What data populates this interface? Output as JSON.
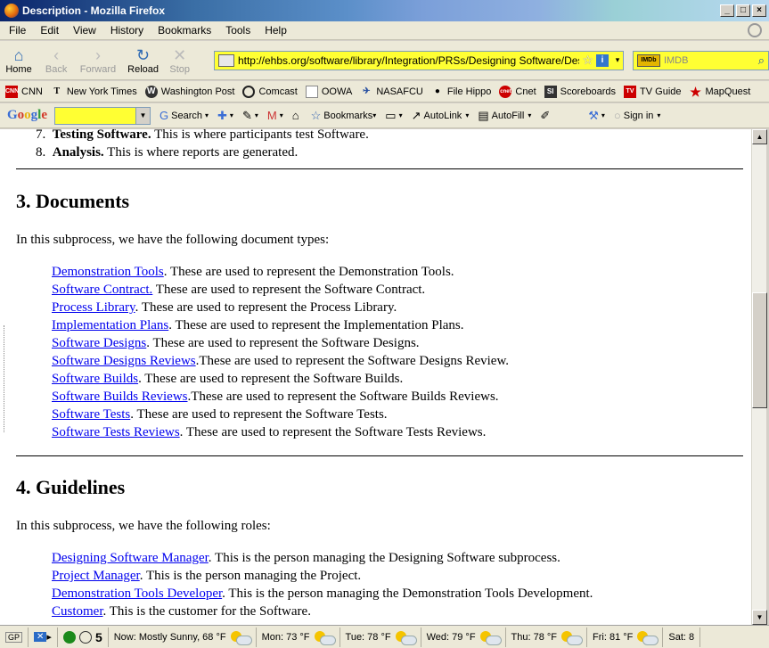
{
  "window": {
    "title": "Description - Mozilla Firefox"
  },
  "menu": [
    "File",
    "Edit",
    "View",
    "History",
    "Bookmarks",
    "Tools",
    "Help"
  ],
  "nav": {
    "home": "Home",
    "back": "Back",
    "forward": "Forward",
    "reload": "Reload",
    "stop": "Stop",
    "url": "http://ehbs.org/software/library/Integration/PRSs/Designing Software/Descr",
    "search_placeholder": "IMDB",
    "search_engine": "IMDb"
  },
  "bookmarks": [
    "CNN",
    "New York Times",
    "Washington Post",
    "Comcast",
    "OOWA",
    "NASAFCU",
    "File Hippo",
    "Cnet",
    "Scoreboards",
    "TV Guide",
    "MapQuest"
  ],
  "google_toolbar": {
    "logo": [
      "G",
      "o",
      "o",
      "g",
      "l",
      "e"
    ],
    "search": "Search",
    "bookmarks": "Bookmarks",
    "autolink": "AutoLink",
    "autofill": "AutoFill",
    "signin": "Sign in"
  },
  "content": {
    "steps": [
      {
        "num": "7.",
        "bold": "Testing Software.",
        "text": " This is where participants test Software."
      },
      {
        "num": "8.",
        "bold": "Analysis.",
        "text": " This is where reports are generated."
      }
    ],
    "documents": {
      "heading": "3. Documents",
      "intro": "In this subprocess, we have the following document types:",
      "items": [
        {
          "link": "Demonstration Tools",
          "text": ". These are used to represent the Demonstration Tools."
        },
        {
          "link": "Software Contract.",
          "text": " These are used to represent the Software Contract."
        },
        {
          "link": "Process Library",
          "text": ". These are used to represent the Process Library."
        },
        {
          "link": "Implementation Plans",
          "text": ". These are used to represent the Implementation Plans."
        },
        {
          "link": "Software Designs",
          "text": ". These are used to represent the Software Designs."
        },
        {
          "link": "Software Designs Reviews",
          "text": ".These are used to represent the Software Designs Review."
        },
        {
          "link": "Software Builds",
          "text": ". These are used to represent the Software Builds."
        },
        {
          "link": "Software Builds Reviews",
          "text": ".These are used to represent the Software Builds Reviews."
        },
        {
          "link": "Software Tests",
          "text": ". These are used to represent the Software Tests."
        },
        {
          "link": "Software Tests Reviews",
          "text": ". These are used to represent the Software Tests Reviews."
        }
      ]
    },
    "guidelines": {
      "heading": "4. Guidelines",
      "intro": "In this subprocess, we have the following roles:",
      "items": [
        {
          "link": "Designing Software Manager",
          "text": ". This is the person managing the Designing Software subprocess."
        },
        {
          "link": "Project Manager",
          "text": ". This is the person managing the Project."
        },
        {
          "link": "Demonstration Tools Developer",
          "text": ". This is the person managing the Demonstration Tools Development."
        },
        {
          "link": "Customer",
          "text": ". This is the customer for the Software."
        }
      ]
    }
  },
  "status": {
    "gp": "GP",
    "tab_count": "5",
    "weather": [
      "Now: Mostly Sunny, 68 °F",
      "Mon: 73 °F",
      "Tue: 78 °F",
      "Wed: 79 °F",
      "Thu: 78 °F",
      "Fri: 81 °F",
      "Sat: 8"
    ]
  }
}
